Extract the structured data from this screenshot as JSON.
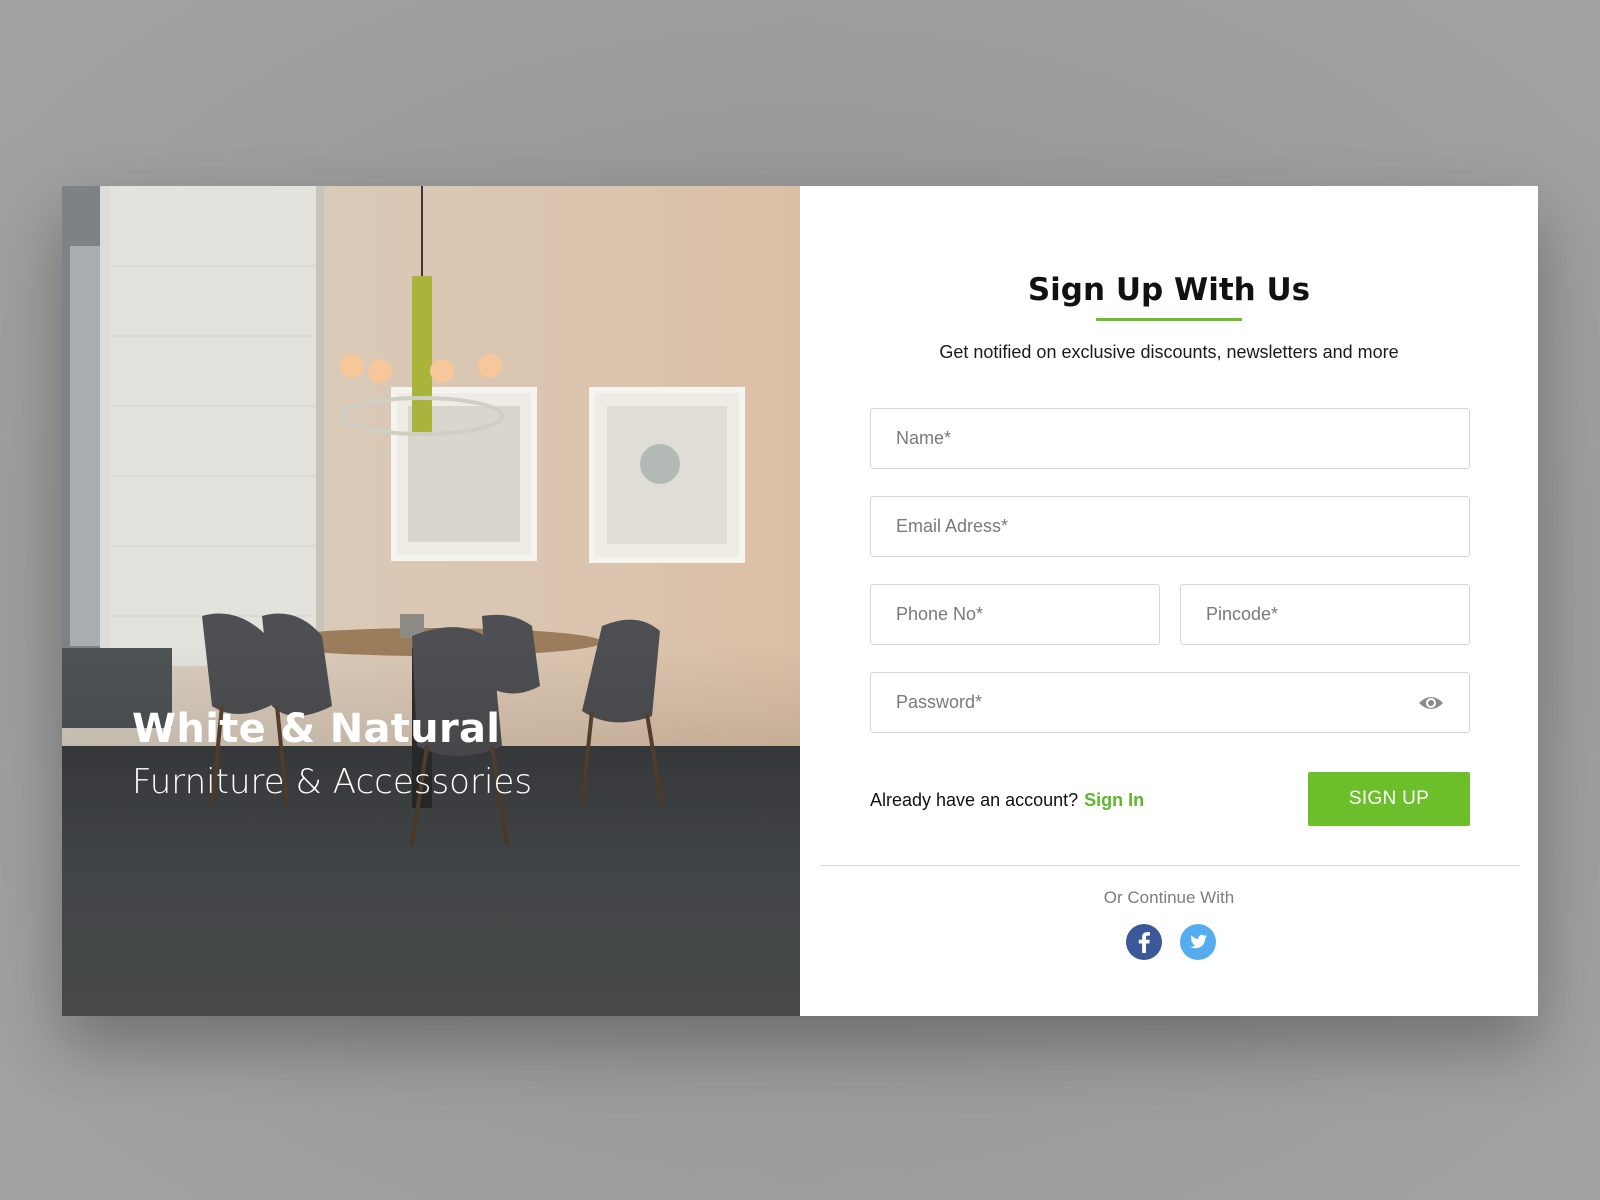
{
  "hero": {
    "title": "White & Natural",
    "subtitle": "Furniture & Accessories"
  },
  "form": {
    "title": "Sign Up With Us",
    "subtitle": "Get notified on exclusive discounts, newsletters and more",
    "name_placeholder": "Name*",
    "email_placeholder": "Email Adress*",
    "phone_placeholder": "Phone No*",
    "pincode_placeholder": "Pincode*",
    "password_placeholder": "Password*",
    "password_toggle_icon": "eye-icon",
    "account_prompt": "Already have an account?",
    "sign_in_label": "Sign In",
    "sign_up_label": "SIGN UP",
    "or_continue": "Or Continue With"
  },
  "social": [
    {
      "icon": "facebook-icon",
      "color": "#3b5998"
    },
    {
      "icon": "twitter-icon",
      "color": "#55acee"
    }
  ],
  "colors": {
    "accent": "#6cbe2b",
    "link": "#5cb82a",
    "background": "#9a9a9a"
  }
}
